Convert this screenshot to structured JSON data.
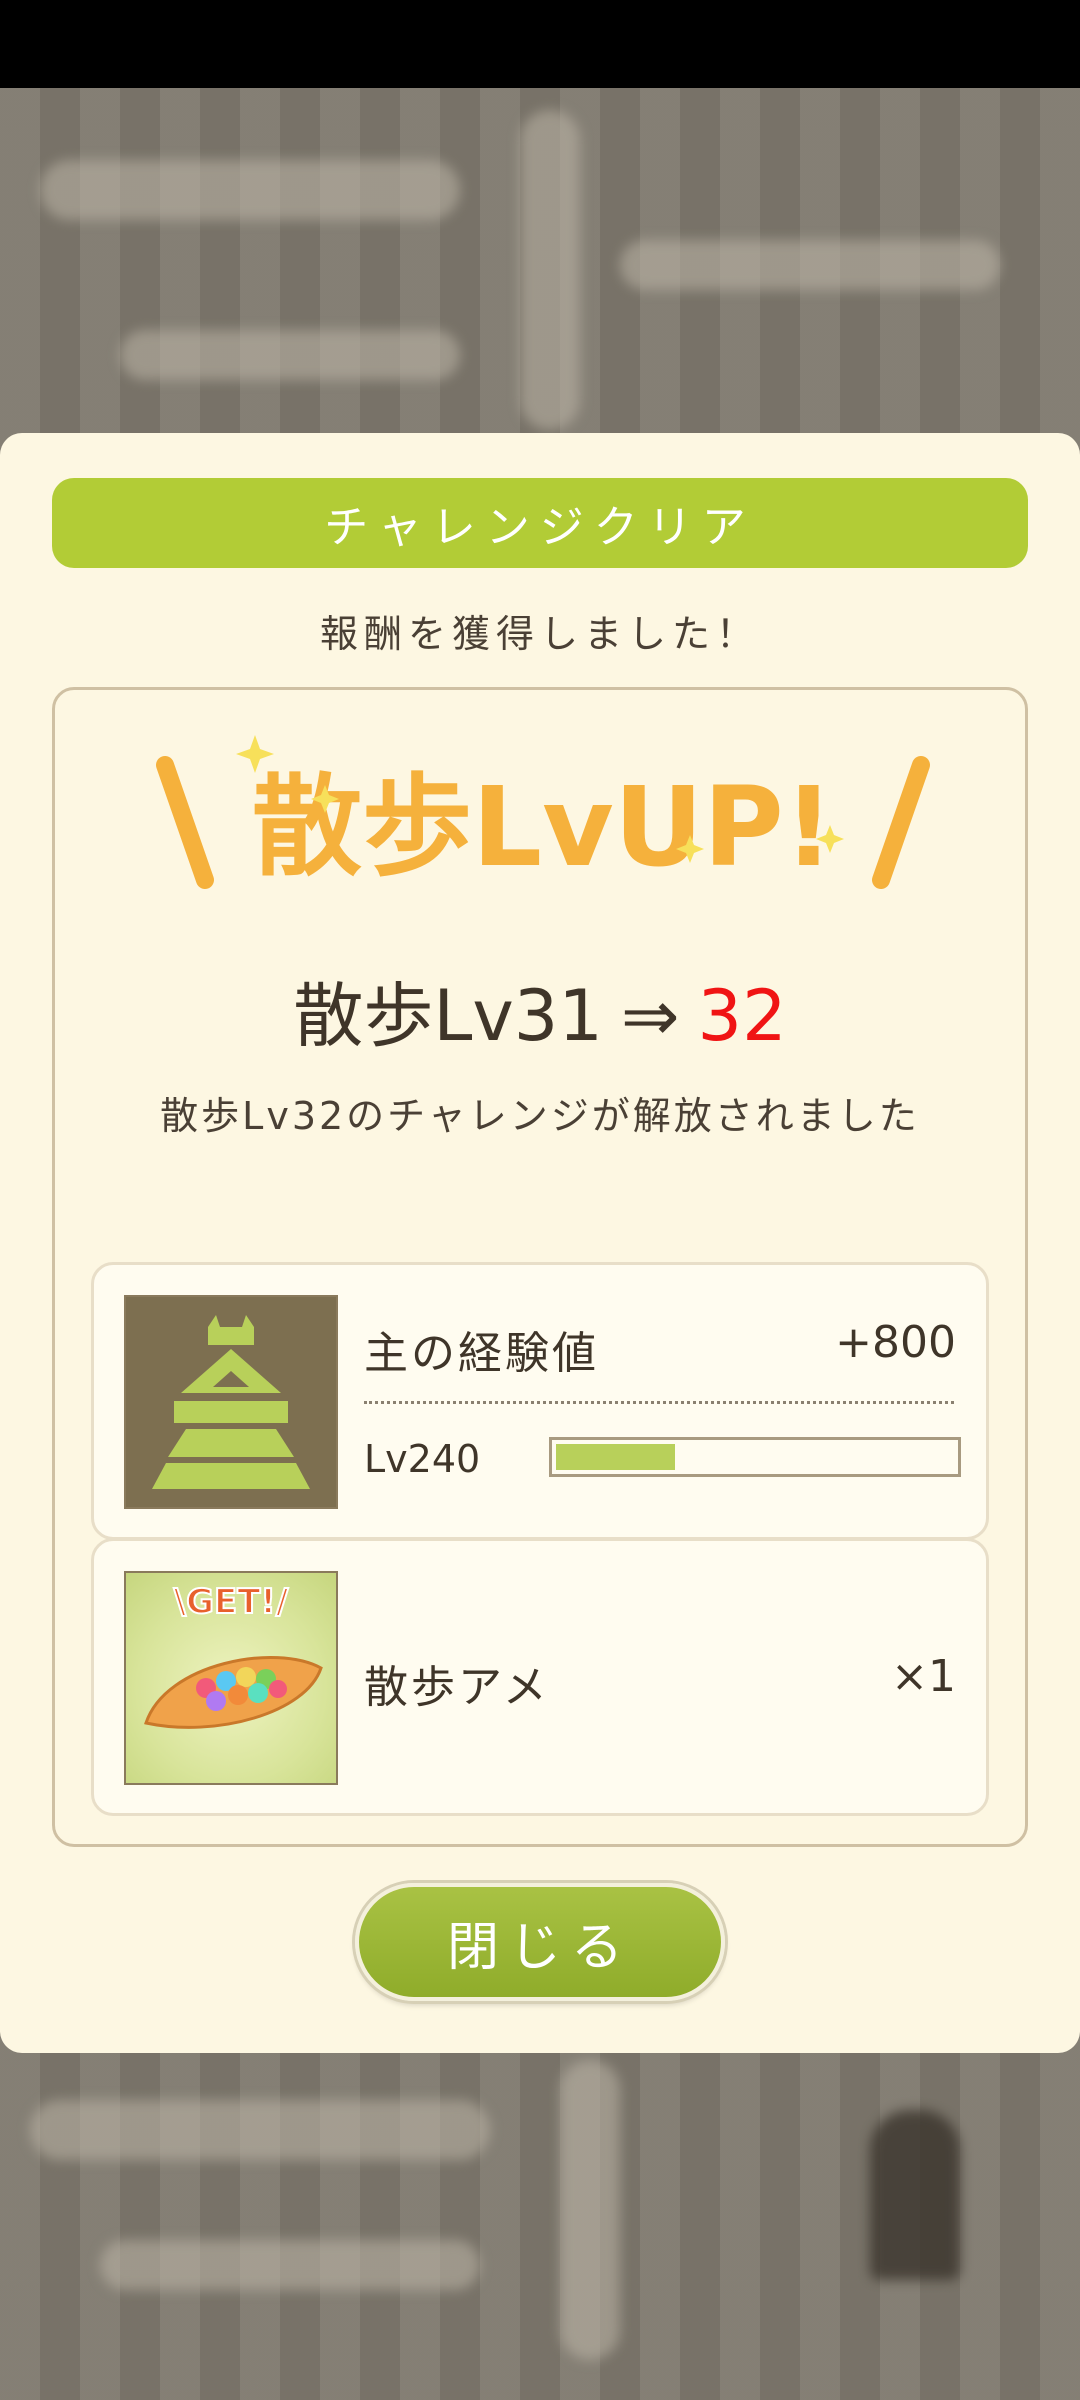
{
  "dialog": {
    "header": "チャレンジクリア",
    "subtitle": "報酬を獲得しました！",
    "level_up": {
      "title": "散歩LvUP!",
      "from_label": "散歩Lv31",
      "arrow": "⇒",
      "to_value": "32",
      "unlock_message": "散歩Lv32のチャレンジが解放されました"
    },
    "rewards": {
      "exp": {
        "label": "主の経験値",
        "value": "+800",
        "level": "Lv240",
        "progress": 0.3
      },
      "item": {
        "label": "散歩アメ",
        "quantity": "×1",
        "badge": "\\GET!/"
      }
    },
    "close_label": "閉じる"
  },
  "colors": {
    "accent": "#b2cc36",
    "lvup": "#f5b13c",
    "new_level": "#f01414",
    "panel": "#fdf7e2"
  }
}
